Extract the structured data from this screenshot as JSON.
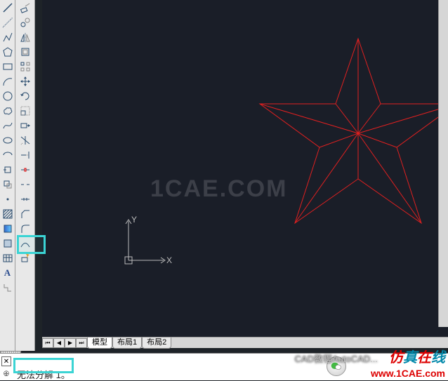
{
  "tabs": {
    "model": "模型",
    "layout1": "布局1",
    "layout2": "布局2"
  },
  "command": {
    "text": "无法分解 1。"
  },
  "watermark": {
    "center": "1CAE.COM",
    "chat_text": "CAD教程AutoCAD...",
    "brand_parts": [
      "仿",
      "真",
      "在",
      "线"
    ],
    "url": "www.1CAE.com"
  },
  "ucs": {
    "x": "X",
    "y": "Y"
  },
  "toolbar1": [
    {
      "name": "line-icon"
    },
    {
      "name": "construction-line-icon"
    },
    {
      "name": "polyline-icon"
    },
    {
      "name": "polygon-icon"
    },
    {
      "name": "rectangle-icon"
    },
    {
      "name": "arc-icon"
    },
    {
      "name": "circle-icon"
    },
    {
      "name": "revcloud-icon"
    },
    {
      "name": "spline-icon"
    },
    {
      "name": "ellipse-icon"
    },
    {
      "name": "ellipse-arc-icon"
    },
    {
      "name": "insert-block-icon"
    },
    {
      "name": "make-block-icon"
    },
    {
      "name": "point-icon"
    },
    {
      "name": "hatch-icon"
    },
    {
      "name": "gradient-icon"
    },
    {
      "name": "region-icon"
    },
    {
      "name": "table-icon"
    },
    {
      "name": "text-icon"
    },
    {
      "name": "add-selected-icon"
    }
  ],
  "toolbar2": [
    {
      "name": "move-icon"
    },
    {
      "name": "copy-icon"
    },
    {
      "name": "mirror-icon"
    },
    {
      "name": "offset-icon"
    },
    {
      "name": "array-icon"
    },
    {
      "name": "nudge-icon"
    },
    {
      "name": "rotate-icon"
    },
    {
      "name": "scale-icon"
    },
    {
      "name": "stretch-icon"
    },
    {
      "name": "trim-icon"
    },
    {
      "name": "extend-icon"
    },
    {
      "name": "break-at-point-icon"
    },
    {
      "name": "break-icon"
    },
    {
      "name": "join-icon"
    },
    {
      "name": "chamfer-icon"
    },
    {
      "name": "fillet-icon"
    },
    {
      "name": "blend-curve-icon"
    },
    {
      "name": "explode-icon"
    }
  ]
}
